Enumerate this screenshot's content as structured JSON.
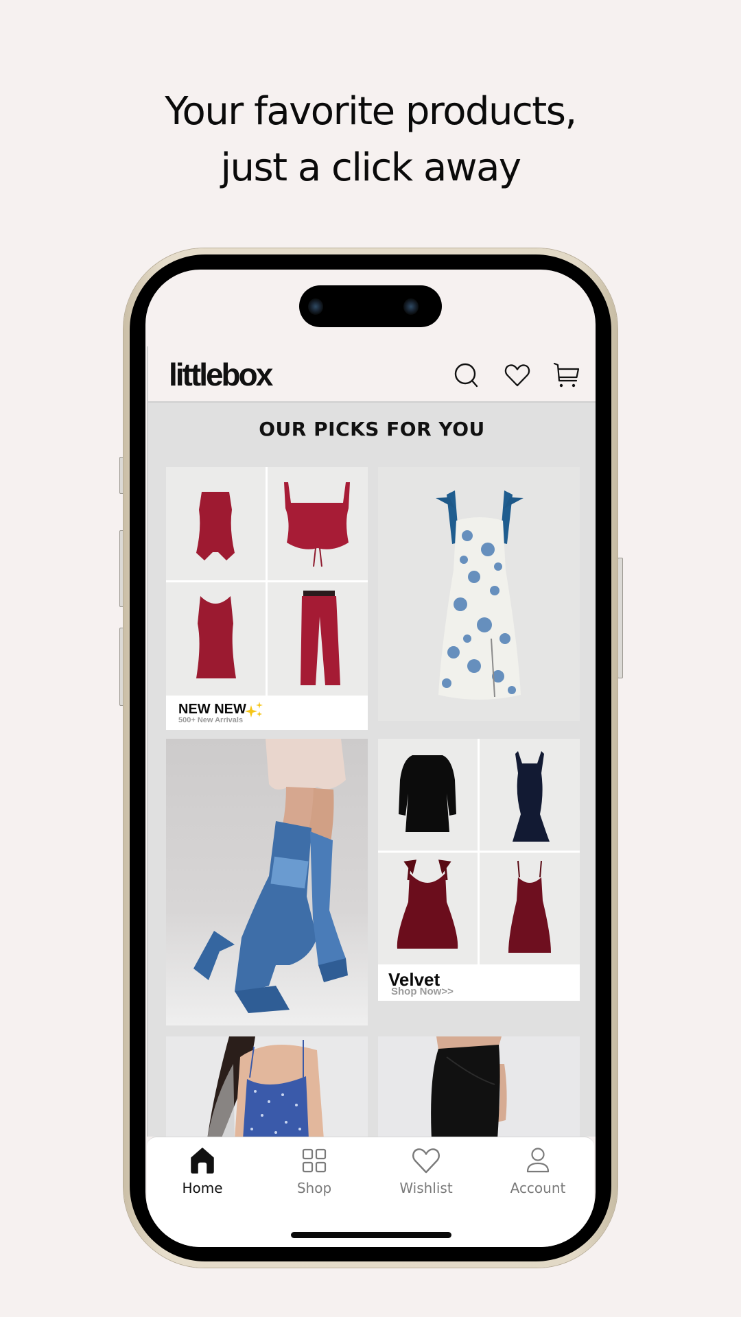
{
  "promo": {
    "headline_line1": "Your favorite products,",
    "headline_line2": "just a click away"
  },
  "app": {
    "brand": "littlebox",
    "header_icons": [
      "search-icon",
      "heart-icon",
      "cart-icon"
    ],
    "section_title": "OUR PICKS FOR YOU",
    "tiles": [
      {
        "type": "collection-grid",
        "title": "NEW NEW",
        "emoji": "✨",
        "subtitle": "500+ New Arrivals",
        "items": [
          "red sleeveless vest",
          "red lace-up corset top",
          "red sleeveless mini dress",
          "red wide-leg trousers"
        ]
      },
      {
        "type": "product-image",
        "item": "blue floral midi dress with tie straps"
      },
      {
        "type": "product-image",
        "item": "denim platform knee-high boots"
      },
      {
        "type": "collection-grid",
        "title": "Velvet",
        "subtitle": "Shop Now>>",
        "items": [
          "black velvet long-sleeve mini dress",
          "navy velvet mermaid maxi dress",
          "burgundy velvet bow-strap dress",
          "burgundy velvet midi slip dress"
        ]
      },
      {
        "type": "product-image",
        "item": "blue ditsy floral cami dress"
      },
      {
        "type": "product-image",
        "item": "black draped midi skirt"
      }
    ]
  },
  "bottom_nav": {
    "active": "Home",
    "items": [
      {
        "label": "Home",
        "icon": "home-icon"
      },
      {
        "label": "Shop",
        "icon": "grid-icon"
      },
      {
        "label": "Wishlist",
        "icon": "heart-icon"
      },
      {
        "label": "Account",
        "icon": "user-icon"
      }
    ]
  },
  "colors": {
    "background": "#f6f1f0",
    "content_bg": "#e0e0e0",
    "frame_gold": "#e2d9c6",
    "text_primary": "#111111",
    "text_muted": "#7a7a7a",
    "caption_sub": "#9a9a9a",
    "sparkle": "#f5c518"
  }
}
